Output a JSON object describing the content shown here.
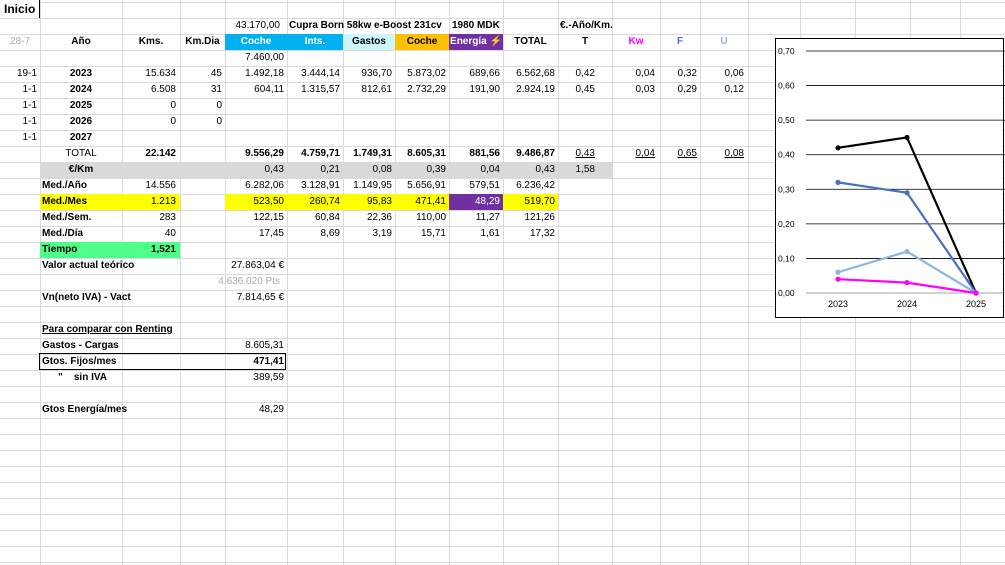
{
  "top_cell": "Inicio",
  "header_row1": {
    "price": "43.170,00",
    "model": "Cupra Born 58kw e-Boost 231cv",
    "plate": "1980 MDK",
    "unit_label": "€.-Año/Km."
  },
  "header_row2": {
    "date": "28-7",
    "year": "Año",
    "kms": "Kms.",
    "kmdia": "Km.Dia",
    "coche": "Coche",
    "ints": "Ints.",
    "gastos": "Gastos",
    "coche2": "Coche",
    "energia": "Energía",
    "total": "TOTAL",
    "t": "T",
    "kw": "Kw",
    "f": "F",
    "u": "U"
  },
  "initial_value": "7.460,00",
  "years": [
    {
      "date": "19-1",
      "year": "2023",
      "kms": "15.634",
      "kmdia": "45",
      "coche": "1.492,18",
      "ints": "3.444,14",
      "gastos": "936,70",
      "coche2": "5.873,02",
      "energia": "689,66",
      "total": "6.562,68",
      "t": "0,42",
      "kw": "0,04",
      "f": "0,32",
      "u": "0,06"
    },
    {
      "date": "1-1",
      "year": "2024",
      "kms": "6.508",
      "kmdia": "31",
      "coche": "604,11",
      "ints": "1.315,57",
      "gastos": "812,61",
      "coche2": "2.732,29",
      "energia": "191,90",
      "total": "2.924,19",
      "t": "0,45",
      "kw": "0,03",
      "f": "0,29",
      "u": "0,12"
    },
    {
      "date": "1-1",
      "year": "2025",
      "kms": "0",
      "kmdia": "0",
      "coche": "",
      "ints": "",
      "gastos": "",
      "coche2": "",
      "energia": "",
      "total": "",
      "t": "",
      "kw": "",
      "f": "",
      "u": ""
    },
    {
      "date": "1-1",
      "year": "2026",
      "kms": "0",
      "kmdia": "0",
      "coche": "",
      "ints": "",
      "gastos": "",
      "coche2": "",
      "energia": "",
      "total": "",
      "t": "",
      "kw": "",
      "f": "",
      "u": ""
    },
    {
      "date": "1-1",
      "year": "2027",
      "kms": "",
      "kmdia": "",
      "coche": "",
      "ints": "",
      "gastos": "",
      "coche2": "",
      "energia": "",
      "total": "",
      "t": "",
      "kw": "",
      "f": "",
      "u": ""
    }
  ],
  "total_row": {
    "label": "TOTAL",
    "kms": "22.142",
    "coche": "9.556,29",
    "ints": "4.759,71",
    "gastos": "1.749,31",
    "coche2": "8.605,31",
    "energia": "881,56",
    "total": "9.486,87",
    "t": "0,43",
    "kw": "0,04",
    "f": "0,65",
    "u": "0,08"
  },
  "eurkm_row": {
    "label": "€/Km",
    "coche": "0,43",
    "ints": "0,21",
    "gastos": "0,08",
    "coche2": "0,39",
    "energia": "0,04",
    "total": "0,43",
    "t": "1,58"
  },
  "med_ano": {
    "label": "Med./Año",
    "kms": "14.556",
    "coche": "6.282,06",
    "ints": "3.128,91",
    "gastos": "1.149,95",
    "coche2": "5.656,91",
    "energia": "579,51",
    "total": "6.236,42"
  },
  "med_mes": {
    "label": "Med./Mes",
    "kms": "1.213",
    "coche": "523,50",
    "ints": "260,74",
    "gastos": "95,83",
    "coche2": "471,41",
    "energia": "48,29",
    "total": "519,70"
  },
  "med_sem": {
    "label": "Med./Sem.",
    "kms": "283",
    "coche": "122,15",
    "ints": "60,84",
    "gastos": "22,36",
    "coche2": "110,00",
    "energia": "11,27",
    "total": "121,26"
  },
  "med_dia": {
    "label": "Med./Día",
    "kms": "40",
    "coche": "17,45",
    "ints": "8,69",
    "gastos": "3,19",
    "coche2": "15,71",
    "energia": "1,61",
    "total": "17,32"
  },
  "tiempo": {
    "label": "Tiempo",
    "value": "1,521"
  },
  "valor_actual": {
    "label": "Valor actual teórico",
    "value": "27.863,04 €",
    "pts": "4.636.020 Pts"
  },
  "vn_neto": {
    "label": "Vn(neto IVA) - Vact",
    "value": "7.814,65 €"
  },
  "renting": {
    "title": "Para comparar con Renting",
    "gastos_cargas_label": "Gastos - Cargas",
    "gastos_cargas_value": "8.605,31",
    "fijos_label": "Gtos. Fijos/mes",
    "fijos_value": "471,41",
    "sin_iva_label": "\"    sin IVA",
    "sin_iva_value": "389,59"
  },
  "energia_mes": {
    "label": "Gtos Energía/mes",
    "value": "48,29"
  },
  "colors": {
    "coche": "#00b0f0",
    "ints": "#00b0f0",
    "gastos": "#ccf5ff",
    "coche2": "#ffc000",
    "energia": "#7030a0",
    "yellow": "#ffff00",
    "tiempo": "#4dff88",
    "gray": "#d9d9d9"
  },
  "chart_data": {
    "type": "line",
    "categories": [
      "2023",
      "2024",
      "2025"
    ],
    "ylim": [
      0,
      0.7
    ],
    "yticks": [
      "0,00",
      "0,10",
      "0,20",
      "0,30",
      "0,40",
      "0,50",
      "0,60",
      "0,70"
    ],
    "series": [
      {
        "color": "#000000",
        "values": [
          0.42,
          0.45,
          0
        ]
      },
      {
        "color": "#4472c4",
        "values": [
          0.32,
          0.29,
          0
        ]
      },
      {
        "color": "#8eb4e3",
        "values": [
          0.06,
          0.12,
          0
        ]
      },
      {
        "color": "#ff00ff",
        "values": [
          0.04,
          0.03,
          0
        ]
      }
    ]
  }
}
